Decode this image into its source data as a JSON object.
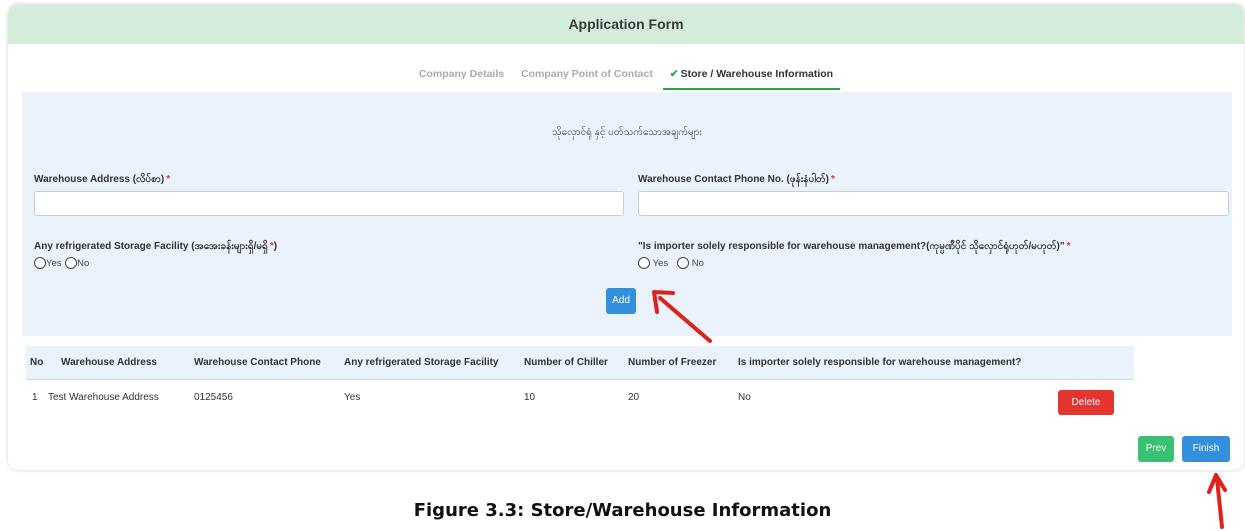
{
  "header": {
    "title": "Application Form"
  },
  "tabs": [
    {
      "label": "Company Details",
      "active": false
    },
    {
      "label": "Company Point of Contact",
      "active": false
    },
    {
      "label": "Store / Warehouse Information",
      "active": true,
      "icon": "check-icon"
    }
  ],
  "form": {
    "section_title": "သိုလှောင်ရုံ နှင့် ပတ်သက်သောအချက်များ",
    "warehouse_address": {
      "label": "Warehouse Address (လိပ်စာ)",
      "required_mark": "*",
      "value": ""
    },
    "warehouse_phone": {
      "label": "Warehouse Contact Phone No. (ဖုန်းနံပါတ်)",
      "required_mark": "*",
      "value": ""
    },
    "refrigerated": {
      "label": "Any refrigerated Storage Facility (အအေးခန်းများရှိ/မရှိ",
      "required_mark": "*",
      "label_suffix": ")",
      "options": [
        "Yes",
        "No"
      ]
    },
    "importer_responsible": {
      "label": "\"Is importer solely responsible for warehouse management?(ကုမ္ပဏီပိုင် သိုလှောင်ရုံဟုတ်/မဟုတ်)\"",
      "required_mark": "*",
      "options": [
        "Yes",
        "No"
      ]
    },
    "add_label": "Add"
  },
  "table": {
    "columns": [
      "No",
      "Warehouse Address",
      "Warehouse Contact Phone",
      "Any refrigerated Storage Facility",
      "Number of Chiller",
      "Number of Freezer",
      "Is importer solely responsible for warehouse management?"
    ],
    "rows": [
      {
        "no": "1",
        "address": "Test Warehouse Address",
        "phone": "0125456",
        "refrigerated": "Yes",
        "chiller": "10",
        "freezer": "20",
        "importer_responsible": "No",
        "delete_label": "Delete"
      }
    ]
  },
  "footer": {
    "prev_label": "Prev",
    "finish_label": "Finish"
  },
  "caption": "Figure 3.3: Store/Warehouse Information",
  "colors": {
    "header_bg": "#d4edda",
    "form_bg": "#eaf2fb",
    "primary": "#3490dc",
    "danger": "#e3342f",
    "success": "#38c172",
    "annotation_arrow": "#e0201b"
  }
}
